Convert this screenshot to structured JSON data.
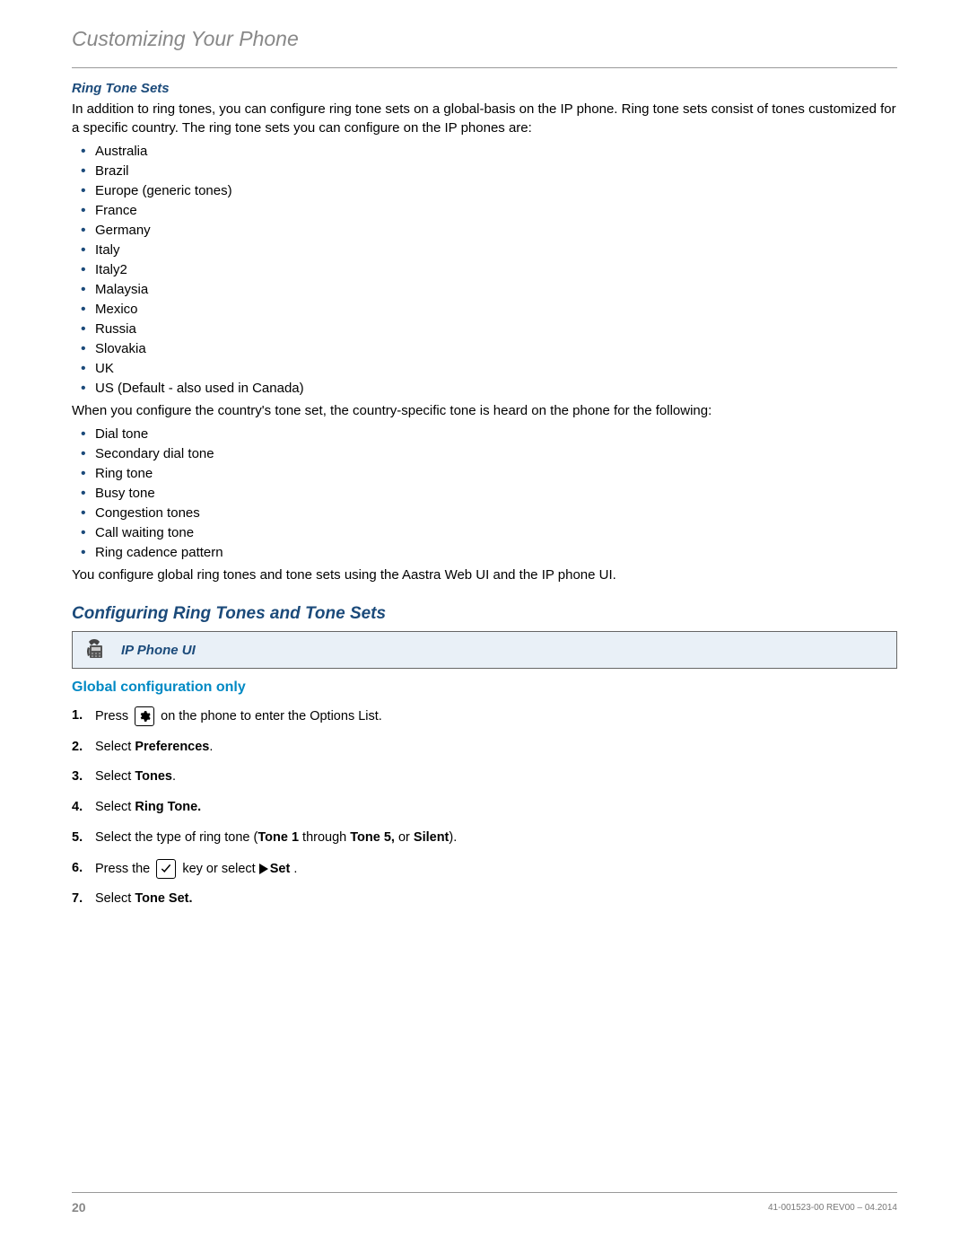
{
  "header": "Customizing Your Phone",
  "ringToneSets": {
    "heading": "Ring Tone Sets",
    "intro": "In addition to ring tones, you can configure ring tone sets on a global-basis on the IP phone. Ring tone sets consist of tones customized for a specific country. The ring tone sets you can configure on the IP phones are:",
    "countries": [
      "Australia",
      "Brazil",
      "Europe (generic tones)",
      "France",
      "Germany",
      "Italy",
      "Italy2",
      "Malaysia",
      "Mexico",
      "Russia",
      "Slovakia",
      "UK",
      "US (Default - also used in Canada)"
    ],
    "whenConfigure": "When you configure the country's tone set, the country-specific tone is heard on the phone for the following:",
    "tones": [
      "Dial tone",
      "Secondary dial tone",
      "Ring tone",
      "Busy tone",
      "Congestion tones",
      "Call waiting tone",
      "Ring cadence pattern"
    ],
    "closing": "You configure global ring tones and tone sets using the Aastra Web UI and the IP phone UI."
  },
  "configuring": {
    "heading": "Configuring Ring Tones and Tone Sets",
    "uiBoxTitle": "IP Phone UI",
    "subHeading": "Global configuration only",
    "steps": {
      "s1a": "Press",
      "s1b": "on the phone to enter the Options List.",
      "s2a": "Select ",
      "s2b": "Preferences",
      "s2c": ".",
      "s3a": "Select ",
      "s3b": "Tones",
      "s3c": ".",
      "s4a": "Select ",
      "s4b": "Ring Tone.",
      "s5a": "Select the type of ring tone (",
      "s5b": "Tone 1",
      "s5c": " through ",
      "s5d": "Tone 5, ",
      "s5e": "or ",
      "s5f": "Silent",
      "s5g": ").",
      "s6a": "Press the ",
      "s6b": " key or select ",
      "s6c": "Set",
      "s6d": " .",
      "s7a": "Select ",
      "s7b": "Tone Set."
    }
  },
  "footer": {
    "page": "20",
    "rev": "41-001523-00 REV00 – 04.2014"
  }
}
